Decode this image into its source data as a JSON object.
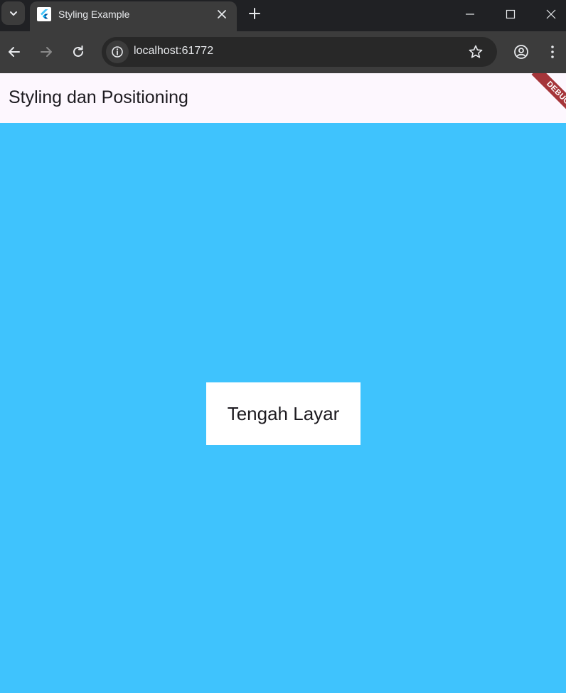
{
  "browser": {
    "tab": {
      "title": "Styling Example"
    },
    "address_bar": {
      "url": "localhost:61772"
    }
  },
  "app": {
    "appbar_title": "Styling dan Positioning",
    "debug_banner": "DEBUG",
    "center_text": "Tengah Layar"
  },
  "colors": {
    "body_background": "#3fc3fd",
    "appbar_background": "#fdf7fe",
    "debug_banner": "#a5353a"
  },
  "icons": {
    "tab_search": "chevron-down-icon",
    "favicon": "flutter-icon",
    "tab_close": "close-icon",
    "new_tab": "plus-icon",
    "back": "arrow-left-icon",
    "forward": "arrow-right-icon",
    "reload": "reload-icon",
    "site_info": "info-icon",
    "bookmark": "star-icon",
    "profile": "profile-icon",
    "menu": "more-vertical-icon"
  }
}
